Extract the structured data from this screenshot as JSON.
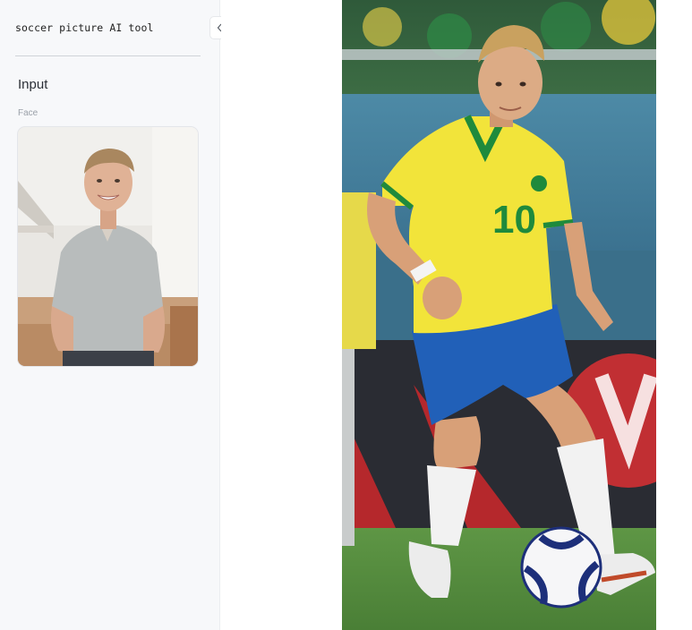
{
  "app": {
    "title": "soccer picture AI tool"
  },
  "sidebar": {
    "section_title": "Input",
    "face_field_label": "Face",
    "collapse_icon": "double-chevron-left-icon"
  },
  "result": {
    "jersey_number": "10"
  },
  "colors": {
    "sidebar_bg": "#f7f8fa",
    "jersey_yellow": "#f2e43a",
    "jersey_green": "#1f8a3c",
    "shorts_blue": "#1f5fb5",
    "pitch_green": "#4f8a3a"
  }
}
